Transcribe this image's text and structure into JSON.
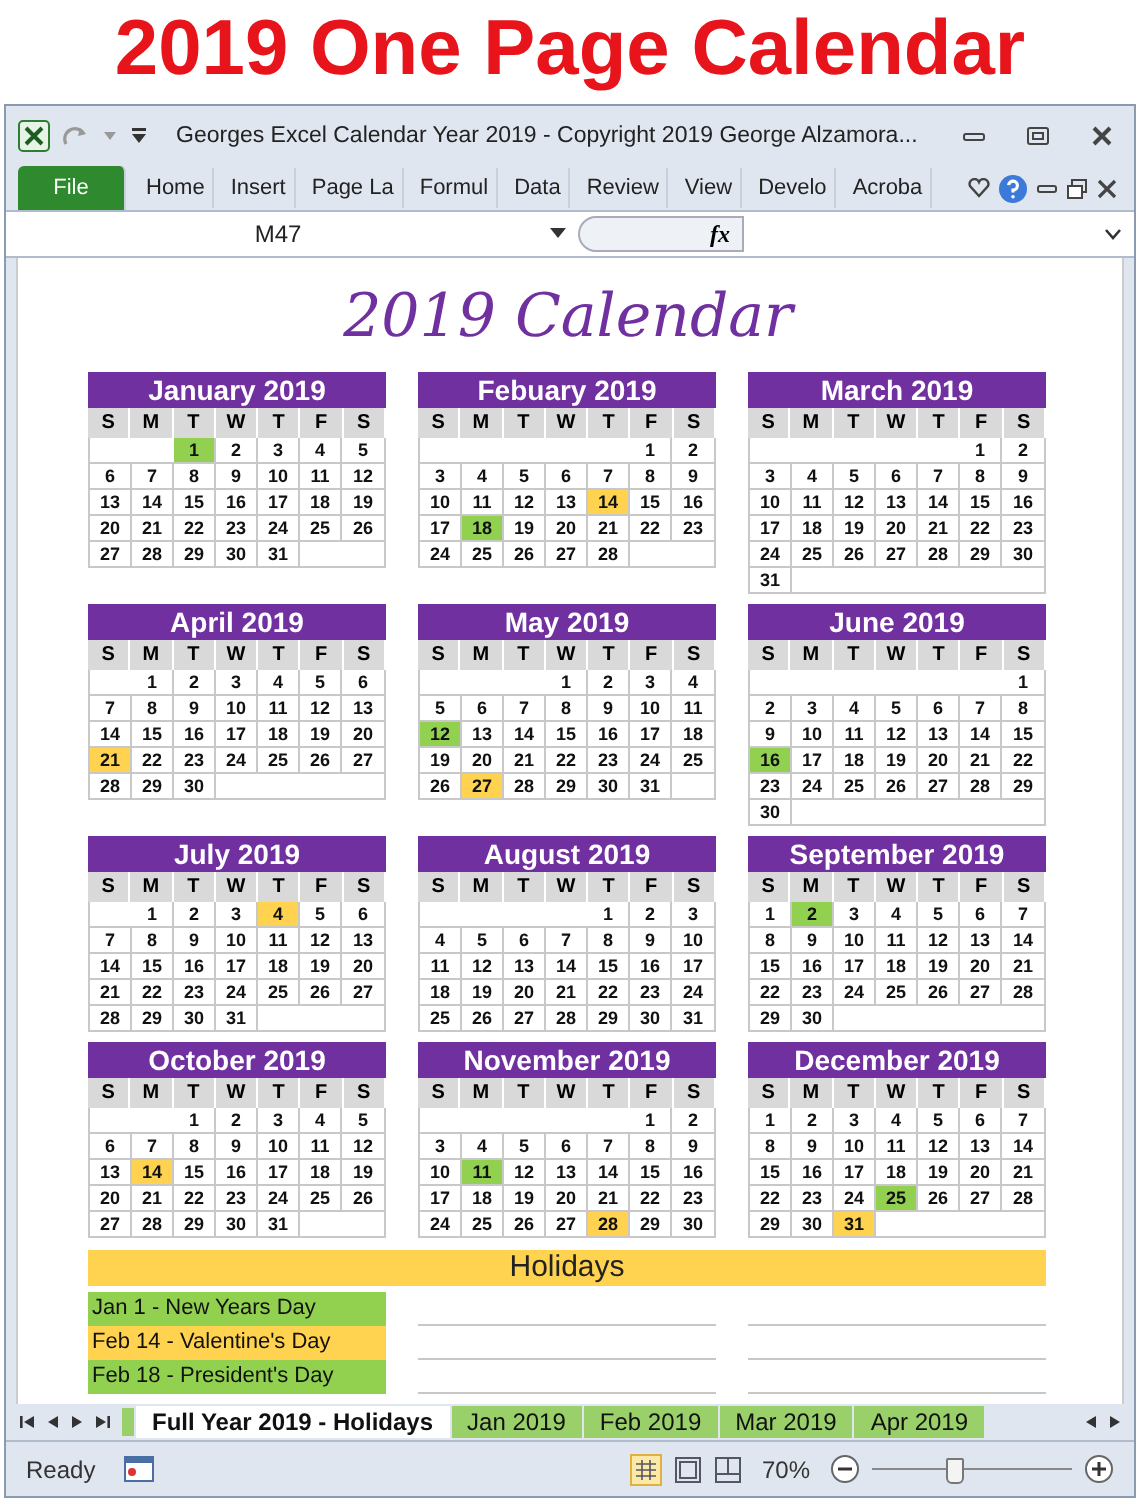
{
  "page_title": "2019 One Page Calendar",
  "window": {
    "title": "Georges Excel Calendar Year 2019 - Copyright 2019 George Alzamora..."
  },
  "ribbon_tabs": [
    {
      "label": "File",
      "kind": "file"
    },
    {
      "label": "Home",
      "kind": "tab"
    },
    {
      "label": "Insert",
      "kind": "tab"
    },
    {
      "label": "Page La",
      "kind": "tab"
    },
    {
      "label": "Formul",
      "kind": "tab"
    },
    {
      "label": "Data",
      "kind": "tab"
    },
    {
      "label": "Review",
      "kind": "tab"
    },
    {
      "label": "View",
      "kind": "tab"
    },
    {
      "label": "Develo",
      "kind": "tab"
    },
    {
      "label": "Acroba",
      "kind": "tab"
    }
  ],
  "formula_bar": {
    "name_box": "M47",
    "fx": "fx"
  },
  "sheet": {
    "heading": "2019 Calendar",
    "months": [
      {
        "name": "January 2019",
        "weekdays": [
          "S",
          "M",
          "T",
          "W",
          "T",
          "F",
          "S"
        ],
        "weeks": [
          {
            "kind": "first",
            "days": [
              {
                "text": "1",
                "color": "#92d050"
              },
              "2",
              "3",
              "4",
              "5"
            ]
          },
          {
            "kind": "full",
            "days": [
              "6",
              "7",
              "8",
              "9",
              "10",
              "11",
              "12"
            ]
          },
          {
            "kind": "full",
            "days": [
              "13",
              "14",
              "15",
              "16",
              "17",
              "18",
              "19"
            ]
          },
          {
            "kind": "full",
            "days": [
              "20",
              "21",
              "22",
              "23",
              "24",
              "25",
              "26"
            ]
          },
          {
            "kind": "last",
            "days": [
              "27",
              "28",
              "29",
              "30",
              "31"
            ]
          }
        ]
      },
      {
        "name": "Febuary 2019",
        "weekdays": [
          "S",
          "M",
          "T",
          "W",
          "T",
          "F",
          "S"
        ],
        "weeks": [
          {
            "kind": "first",
            "days": [
              "1",
              "2"
            ]
          },
          {
            "kind": "full",
            "days": [
              "3",
              "4",
              "5",
              "6",
              "7",
              "8",
              "9"
            ]
          },
          {
            "kind": "full",
            "days": [
              "10",
              "11",
              "12",
              "13",
              {
                "text": "14",
                "color": "#ffd34f"
              },
              "15",
              "16"
            ]
          },
          {
            "kind": "full",
            "days": [
              "17",
              {
                "text": "18",
                "color": "#92d050"
              },
              "19",
              "20",
              "21",
              "22",
              "23"
            ]
          },
          {
            "kind": "last",
            "days": [
              "24",
              "25",
              "26",
              "27",
              "28"
            ]
          }
        ]
      },
      {
        "name": "March 2019",
        "weekdays": [
          "S",
          "M",
          "T",
          "W",
          "T",
          "F",
          "S"
        ],
        "weeks": [
          {
            "kind": "first",
            "days": [
              "1",
              "2"
            ]
          },
          {
            "kind": "full",
            "days": [
              "3",
              "4",
              "5",
              "6",
              "7",
              "8",
              "9"
            ]
          },
          {
            "kind": "full",
            "days": [
              "10",
              "11",
              "12",
              "13",
              "14",
              "15",
              "16"
            ]
          },
          {
            "kind": "full",
            "days": [
              "17",
              "18",
              "19",
              "20",
              "21",
              "22",
              "23"
            ]
          },
          {
            "kind": "full",
            "days": [
              "24",
              "25",
              "26",
              "27",
              "28",
              "29",
              "30"
            ]
          },
          {
            "kind": "last",
            "days": [
              "31"
            ]
          }
        ]
      },
      {
        "name": "April 2019",
        "weekdays": [
          "S",
          "M",
          "T",
          "W",
          "T",
          "F",
          "S"
        ],
        "weeks": [
          {
            "kind": "first",
            "days": [
              "1",
              "2",
              "3",
              "4",
              "5",
              "6"
            ]
          },
          {
            "kind": "full",
            "days": [
              "7",
              "8",
              "9",
              "10",
              "11",
              "12",
              "13"
            ]
          },
          {
            "kind": "full",
            "days": [
              "14",
              "15",
              "16",
              "17",
              "18",
              "19",
              "20"
            ]
          },
          {
            "kind": "full",
            "days": [
              {
                "text": "21",
                "color": "#ffd34f"
              },
              "22",
              "23",
              "24",
              "25",
              "26",
              "27"
            ]
          },
          {
            "kind": "last",
            "days": [
              "28",
              "29",
              "30"
            ]
          }
        ]
      },
      {
        "name": "May 2019",
        "weekdays": [
          "S",
          "M",
          "T",
          "W",
          "T",
          "F",
          "S"
        ],
        "weeks": [
          {
            "kind": "first",
            "days": [
              "1",
              "2",
              "3",
              "4"
            ]
          },
          {
            "kind": "full",
            "days": [
              "5",
              "6",
              "7",
              "8",
              "9",
              "10",
              "11"
            ]
          },
          {
            "kind": "full",
            "days": [
              {
                "text": "12",
                "color": "#92d050"
              },
              "13",
              "14",
              "15",
              "16",
              "17",
              "18"
            ]
          },
          {
            "kind": "full",
            "days": [
              "19",
              "20",
              "21",
              "22",
              "23",
              "24",
              "25"
            ]
          },
          {
            "kind": "last",
            "days": [
              "26",
              {
                "text": "27",
                "color": "#ffd34f"
              },
              "28",
              "29",
              "30",
              "31"
            ]
          }
        ]
      },
      {
        "name": "June 2019",
        "weekdays": [
          "S",
          "M",
          "T",
          "W",
          "T",
          "F",
          "S"
        ],
        "weeks": [
          {
            "kind": "first",
            "days": [
              "1"
            ]
          },
          {
            "kind": "full",
            "days": [
              "2",
              "3",
              "4",
              "5",
              "6",
              "7",
              "8"
            ]
          },
          {
            "kind": "full",
            "days": [
              "9",
              "10",
              "11",
              "12",
              "13",
              "14",
              "15"
            ]
          },
          {
            "kind": "full",
            "days": [
              {
                "text": "16",
                "color": "#92d050"
              },
              "17",
              "18",
              "19",
              "20",
              "21",
              "22"
            ]
          },
          {
            "kind": "full",
            "days": [
              "23",
              "24",
              "25",
              "26",
              "27",
              "28",
              "29"
            ]
          },
          {
            "kind": "last",
            "days": [
              "30"
            ]
          }
        ]
      },
      {
        "name": "July 2019",
        "weekdays": [
          "S",
          "M",
          "T",
          "W",
          "T",
          "F",
          "S"
        ],
        "weeks": [
          {
            "kind": "first",
            "days": [
              "1",
              "2",
              "3",
              {
                "text": "4",
                "color": "#ffd34f"
              },
              "5",
              "6"
            ]
          },
          {
            "kind": "full",
            "days": [
              "7",
              "8",
              "9",
              "10",
              "11",
              "12",
              "13"
            ]
          },
          {
            "kind": "full",
            "days": [
              "14",
              "15",
              "16",
              "17",
              "18",
              "19",
              "20"
            ]
          },
          {
            "kind": "full",
            "days": [
              "21",
              "22",
              "23",
              "24",
              "25",
              "26",
              "27"
            ]
          },
          {
            "kind": "last",
            "days": [
              "28",
              "29",
              "30",
              "31"
            ]
          }
        ]
      },
      {
        "name": "August 2019",
        "weekdays": [
          "S",
          "M",
          "T",
          "W",
          "T",
          "F",
          "S"
        ],
        "weeks": [
          {
            "kind": "first",
            "days": [
              "1",
              "2",
              "3"
            ]
          },
          {
            "kind": "full",
            "days": [
              "4",
              "5",
              "6",
              "7",
              "8",
              "9",
              "10"
            ]
          },
          {
            "kind": "full",
            "days": [
              "11",
              "12",
              "13",
              "14",
              "15",
              "16",
              "17"
            ]
          },
          {
            "kind": "full",
            "days": [
              "18",
              "19",
              "20",
              "21",
              "22",
              "23",
              "24"
            ]
          },
          {
            "kind": "full",
            "days": [
              "25",
              "26",
              "27",
              "28",
              "29",
              "30",
              "31"
            ]
          }
        ]
      },
      {
        "name": "September 2019",
        "weekdays": [
          "S",
          "M",
          "T",
          "W",
          "T",
          "F",
          "S"
        ],
        "weeks": [
          {
            "kind": "full",
            "days": [
              "1",
              {
                "text": "2",
                "color": "#92d050"
              },
              "3",
              "4",
              "5",
              "6",
              "7"
            ]
          },
          {
            "kind": "full",
            "days": [
              "8",
              "9",
              "10",
              "11",
              "12",
              "13",
              "14"
            ]
          },
          {
            "kind": "full",
            "days": [
              "15",
              "16",
              "17",
              "18",
              "19",
              "20",
              "21"
            ]
          },
          {
            "kind": "full",
            "days": [
              "22",
              "23",
              "24",
              "25",
              "26",
              "27",
              "28"
            ]
          },
          {
            "kind": "last",
            "days": [
              "29",
              "30"
            ]
          }
        ]
      },
      {
        "name": "October 2019",
        "weekdays": [
          "S",
          "M",
          "T",
          "W",
          "T",
          "F",
          "S"
        ],
        "weeks": [
          {
            "kind": "first",
            "days": [
              "1",
              "2",
              "3",
              "4",
              "5"
            ]
          },
          {
            "kind": "full",
            "days": [
              "6",
              "7",
              "8",
              "9",
              "10",
              "11",
              "12"
            ]
          },
          {
            "kind": "full",
            "days": [
              "13",
              {
                "text": "14",
                "color": "#ffd34f"
              },
              "15",
              "16",
              "17",
              "18",
              "19"
            ]
          },
          {
            "kind": "full",
            "days": [
              "20",
              "21",
              "22",
              "23",
              "24",
              "25",
              "26"
            ]
          },
          {
            "kind": "last",
            "days": [
              "27",
              "28",
              "29",
              "30",
              "31"
            ]
          }
        ]
      },
      {
        "name": "November 2019",
        "weekdays": [
          "S",
          "M",
          "T",
          "W",
          "T",
          "F",
          "S"
        ],
        "weeks": [
          {
            "kind": "first",
            "days": [
              "1",
              "2"
            ]
          },
          {
            "kind": "full",
            "days": [
              "3",
              "4",
              "5",
              "6",
              "7",
              "8",
              "9"
            ]
          },
          {
            "kind": "full",
            "days": [
              "10",
              {
                "text": "11",
                "color": "#92d050"
              },
              "12",
              "13",
              "14",
              "15",
              "16"
            ]
          },
          {
            "kind": "full",
            "days": [
              "17",
              "18",
              "19",
              "20",
              "21",
              "22",
              "23"
            ]
          },
          {
            "kind": "full",
            "days": [
              "24",
              "25",
              "26",
              "27",
              {
                "text": "28",
                "color": "#ffd34f"
              },
              "29",
              "30"
            ]
          }
        ]
      },
      {
        "name": "December 2019",
        "weekdays": [
          "S",
          "M",
          "T",
          "W",
          "T",
          "F",
          "S"
        ],
        "weeks": [
          {
            "kind": "full",
            "days": [
              "1",
              "2",
              "3",
              "4",
              "5",
              "6",
              "7"
            ]
          },
          {
            "kind": "full",
            "days": [
              "8",
              "9",
              "10",
              "11",
              "12",
              "13",
              "14"
            ]
          },
          {
            "kind": "full",
            "days": [
              "15",
              "16",
              "17",
              "18",
              "19",
              "20",
              "21"
            ]
          },
          {
            "kind": "full",
            "days": [
              "22",
              "23",
              "24",
              {
                "text": "25",
                "color": "#92d050"
              },
              "26",
              "27",
              "28"
            ]
          },
          {
            "kind": "last",
            "days": [
              "29",
              "30",
              {
                "text": "31",
                "color": "#ffd34f"
              }
            ]
          }
        ]
      }
    ],
    "holidays": {
      "title": "Holidays",
      "items": [
        {
          "text": "Jan 1 - New Years Day",
          "color": "#92d050"
        },
        {
          "text": "Feb 14 - Valentine's Day",
          "color": "#ffd34f"
        },
        {
          "text": "Feb 18 - President's Day",
          "color": "#92d050"
        }
      ]
    }
  },
  "sheet_tabs": [
    {
      "label": "Full Year 2019 - Holidays",
      "selected": true
    },
    {
      "label": "Jan 2019",
      "selected": false
    },
    {
      "label": "Feb 2019",
      "selected": false
    },
    {
      "label": "Mar 2019",
      "selected": false
    },
    {
      "label": "Apr 2019",
      "selected": false
    }
  ],
  "status_bar": {
    "status": "Ready",
    "zoom": "70%",
    "zoom_slider": {
      "level": 0.4
    }
  }
}
